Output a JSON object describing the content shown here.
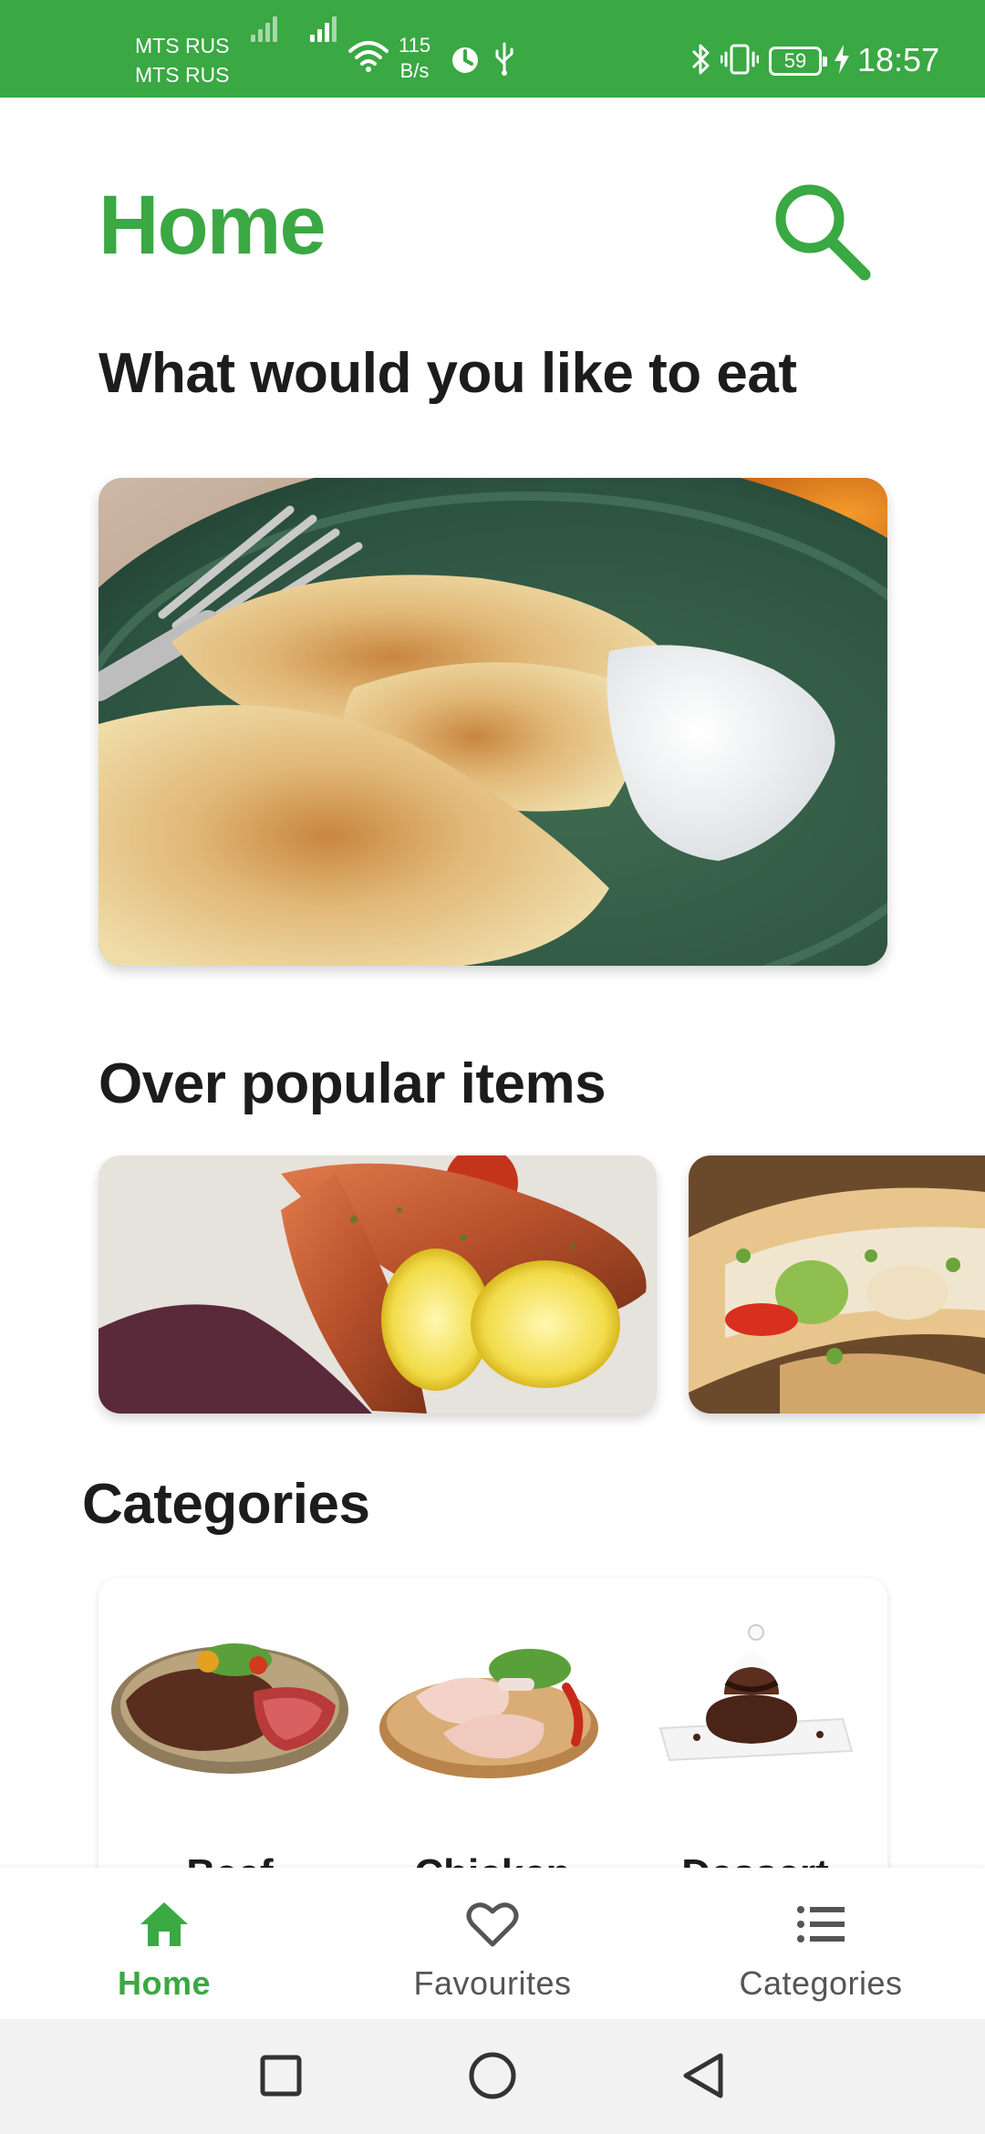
{
  "status_bar": {
    "carrier_1": "MTS RUS",
    "carrier_2": "MTS RUS",
    "net_speed_value": "115",
    "net_speed_unit": "B/s",
    "battery_level": "59",
    "time": "18:57",
    "icons": [
      "signal-icon",
      "signal-icon",
      "wifi-icon",
      "timer-icon",
      "usb-icon",
      "bluetooth-icon",
      "vibrate-icon",
      "battery-icon",
      "charging-icon"
    ]
  },
  "header": {
    "title": "Home",
    "search_icon": "search-icon"
  },
  "hero": {
    "heading": "What would you like to eat",
    "image": "pierogi-with-sour-cream-photo"
  },
  "popular": {
    "heading": "Over popular items",
    "items": [
      {
        "image": "grilled-salmon-with-lemon-photo"
      },
      {
        "image": "fish-tacos-photo"
      }
    ]
  },
  "categories": {
    "heading": "Categories",
    "items": [
      {
        "label": "Beef",
        "image": "grilled-steak-photo"
      },
      {
        "label": "Chicken",
        "image": "raw-chicken-legs-photo"
      },
      {
        "label": "Dessert",
        "image": "chocolate-dessert-photo"
      }
    ]
  },
  "bottom_nav": {
    "items": [
      {
        "label": "Home",
        "icon": "home-icon",
        "active": true
      },
      {
        "label": "Favourites",
        "icon": "heart-icon",
        "active": false
      },
      {
        "label": "Categories",
        "icon": "list-icon",
        "active": false
      }
    ]
  },
  "system_nav": {
    "buttons": [
      "recent-apps-icon",
      "home-circle-icon",
      "back-icon"
    ]
  },
  "colors": {
    "accent": "#3aa843",
    "text": "#1c1c1c",
    "inactive": "#555555"
  }
}
